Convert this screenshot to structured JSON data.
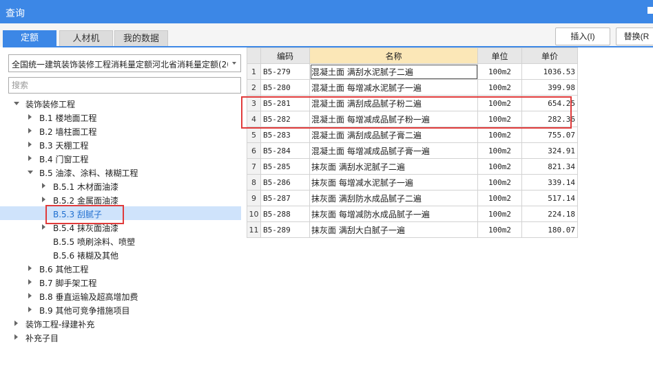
{
  "window": {
    "title": "查询"
  },
  "tabs": [
    {
      "label": "定额",
      "active": true
    },
    {
      "label": "人材机",
      "active": false
    },
    {
      "label": "我的数据",
      "active": false
    }
  ],
  "toolbar": {
    "insert_label": "插入(I)",
    "replace_label": "替换(R"
  },
  "left": {
    "quota_selector": "全国统一建筑装饰装修工程消耗量定额河北省消耗量定额(20",
    "search_placeholder": "搜索",
    "tree": [
      {
        "label": "装饰装修工程",
        "level": 0,
        "expander": "down"
      },
      {
        "label": "B.1 楼地面工程",
        "level": 1,
        "expander": "right"
      },
      {
        "label": "B.2 墙柱面工程",
        "level": 1,
        "expander": "right"
      },
      {
        "label": "B.3 天棚工程",
        "level": 1,
        "expander": "right"
      },
      {
        "label": "B.4 门窗工程",
        "level": 1,
        "expander": "right"
      },
      {
        "label": "B.5 油漆、涂料、裱糊工程",
        "level": 1,
        "expander": "down"
      },
      {
        "label": "B.5.1 木材面油漆",
        "level": 2,
        "expander": "right"
      },
      {
        "label": "B.5.2 金属面油漆",
        "level": 2,
        "expander": "right"
      },
      {
        "label": "B.5.3 刮腻子",
        "level": 2,
        "expander": "none",
        "selected": true
      },
      {
        "label": "B.5.4 抹灰面油漆",
        "level": 2,
        "expander": "right"
      },
      {
        "label": "B.5.5 喷刷涂料、喷塑",
        "level": 2,
        "expander": "none"
      },
      {
        "label": "B.5.6 裱糊及其他",
        "level": 2,
        "expander": "none"
      },
      {
        "label": "B.6 其他工程",
        "level": 1,
        "expander": "right"
      },
      {
        "label": "B.7 脚手架工程",
        "level": 1,
        "expander": "right"
      },
      {
        "label": "B.8 垂直运输及超高增加费",
        "level": 1,
        "expander": "right"
      },
      {
        "label": "B.9 其他可竞争措施项目",
        "level": 1,
        "expander": "right"
      },
      {
        "label": "装饰工程-绿建补充",
        "level": 0,
        "expander": "right"
      },
      {
        "label": "补充子目",
        "level": 0,
        "expander": "right"
      }
    ]
  },
  "table": {
    "headers": {
      "code": "编码",
      "name": "名称",
      "unit": "单位",
      "price": "单价"
    },
    "rows": [
      {
        "n": "1",
        "code": "B5-279",
        "name": "混凝土面 满刮水泥腻子二遍",
        "unit": "100m2",
        "price": "1036.53"
      },
      {
        "n": "2",
        "code": "B5-280",
        "name": "混凝土面 每增减水泥腻子一遍",
        "unit": "100m2",
        "price": "399.98"
      },
      {
        "n": "3",
        "code": "B5-281",
        "name": "混凝土面 满刮成品腻子粉二遍",
        "unit": "100m2",
        "price": "654.25"
      },
      {
        "n": "4",
        "code": "B5-282",
        "name": "混凝土面 每增减成品腻子粉一遍",
        "unit": "100m2",
        "price": "282.36"
      },
      {
        "n": "5",
        "code": "B5-283",
        "name": "混凝土面 满刮成品腻子膏二遍",
        "unit": "100m2",
        "price": "755.07"
      },
      {
        "n": "6",
        "code": "B5-284",
        "name": "混凝土面 每增减成品腻子膏一遍",
        "unit": "100m2",
        "price": "324.91"
      },
      {
        "n": "7",
        "code": "B5-285",
        "name": "抹灰面 满刮水泥腻子二遍",
        "unit": "100m2",
        "price": "821.34"
      },
      {
        "n": "8",
        "code": "B5-286",
        "name": "抹灰面 每增减水泥腻子一遍",
        "unit": "100m2",
        "price": "339.14"
      },
      {
        "n": "9",
        "code": "B5-287",
        "name": "抹灰面 满刮防水成品腻子二遍",
        "unit": "100m2",
        "price": "517.14"
      },
      {
        "n": "10",
        "code": "B5-288",
        "name": "抹灰面 每增减防水成品腻子一遍",
        "unit": "100m2",
        "price": "224.18"
      },
      {
        "n": "11",
        "code": "B5-289",
        "name": "抹灰面 满刮大白腻子一遍",
        "unit": "100m2",
        "price": "180.07"
      }
    ]
  },
  "colors": {
    "accent": "#3c87e6",
    "highlight_box": "#e03a3a",
    "name_header": "#fbe7b7",
    "tree_selection": "#cfe3fb"
  }
}
